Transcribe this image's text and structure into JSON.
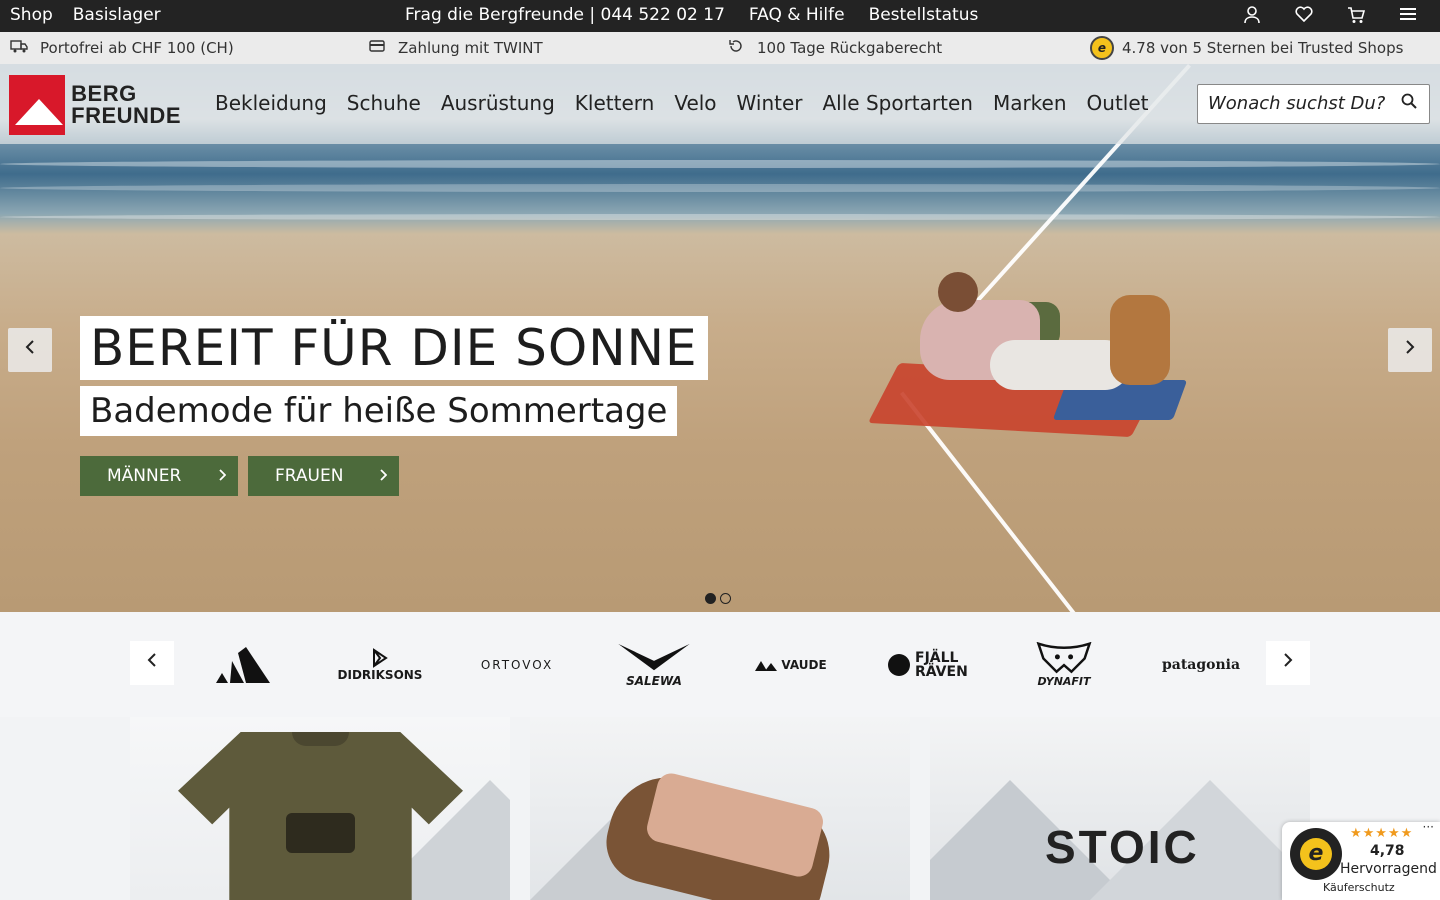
{
  "topbar": {
    "shop": "Shop",
    "basislager": "Basislager",
    "phone": "Frag die Bergfreunde | 044 522 02 17",
    "faq": "FAQ & Hilfe",
    "order_status": "Bestellstatus",
    "icons": [
      "user-icon",
      "heart-icon",
      "cart-icon",
      "menu-icon"
    ]
  },
  "usp": {
    "shipping": "Portofrei ab CHF 100 (CH)",
    "payment": "Zahlung mit TWINT",
    "returns": "100 Tage Rückgaberecht",
    "rating": "4.78 von 5 Sternen bei Trusted Shops"
  },
  "header": {
    "logo_line1": "BERG",
    "logo_line2": "FREUNDE",
    "nav": [
      "Bekleidung",
      "Schuhe",
      "Ausrüstung",
      "Klettern",
      "Velo",
      "Winter",
      "Alle Sportarten",
      "Marken",
      "Outlet"
    ],
    "search_placeholder": "Wonach suchst Du?"
  },
  "hero": {
    "title": "BEREIT FÜR DIE SONNE",
    "subtitle": "Bademode für heiße Sommertage",
    "cta_men": "MÄNNER",
    "cta_women": "FRAUEN",
    "slides_total": 2,
    "active_slide": 1
  },
  "brands": [
    "adidas",
    "DIDRIKSONS",
    "ORTOVOX",
    "SALEWA",
    "VAUDE",
    "FJÄLL RÄVEN",
    "DYNAFIT",
    "patagonia"
  ],
  "tiles": {
    "stoic": "STOIC"
  },
  "trusted_badge": {
    "stars": "★★★★★",
    "score": "4,78",
    "label": "Hervorragend",
    "protection": "Käuferschutz",
    "more": "···"
  },
  "colors": {
    "accent_red": "#d8182a",
    "cta_green": "#4c6a3b",
    "topbar": "#232323"
  }
}
